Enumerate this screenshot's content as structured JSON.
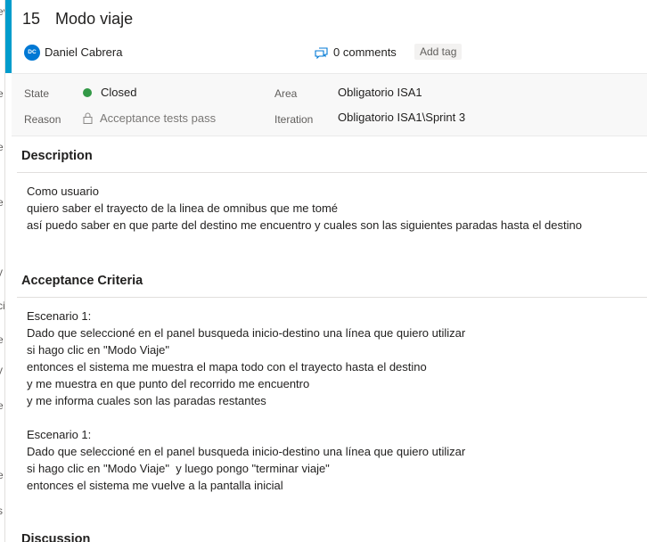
{
  "work_item": {
    "id": "15",
    "title": "Modo viaje",
    "author_initials": "DC",
    "author": "Daniel Cabrera",
    "comments": "0 comments",
    "add_tag": "Add tag"
  },
  "fields": {
    "state_label": "State",
    "state_value": "Closed",
    "state_color": "#339947",
    "reason_label": "Reason",
    "reason_value": "Acceptance tests pass",
    "area_label": "Area",
    "area_value": "Obligatorio ISA1",
    "iteration_label": "Iteration",
    "iteration_value": "Obligatorio ISA1\\Sprint 3"
  },
  "description": {
    "title": "Description",
    "lines": [
      "Como usuario",
      "quiero saber el trayecto de la linea de omnibus que me tomé",
      "así puedo saber en que parte del destino me encuentro y cuales son las siguientes paradas hasta el destino"
    ]
  },
  "acceptance": {
    "title": "Acceptance Criteria",
    "scenario1": [
      "Escenario 1:",
      "Dado que seleccioné en el panel busqueda inicio-destino una línea que quiero utilizar",
      "si hago clic en \"Modo Viaje\"",
      "entonces el sistema me muestra el mapa todo con el trayecto hasta el destino",
      "y me muestra en que punto del recorrido me encuentro",
      "y me informa cuales son las paradas restantes"
    ],
    "scenario2": [
      "Escenario 1:",
      "Dado que seleccioné en el panel busqueda inicio-destino una línea que quiero utilizar",
      "si hago clic en \"Modo Viaje\"  y luego pongo \"terminar viaje\"",
      "entonces el sistema me vuelve a la pantalla inicial"
    ]
  },
  "discussion": {
    "title": "Discussion"
  },
  "left_strip": [
    "ev",
    "e",
    "e",
    "e",
    "y",
    "ci",
    "e",
    "y",
    "e",
    "e",
    "s"
  ],
  "accent_color": "#009ccc"
}
